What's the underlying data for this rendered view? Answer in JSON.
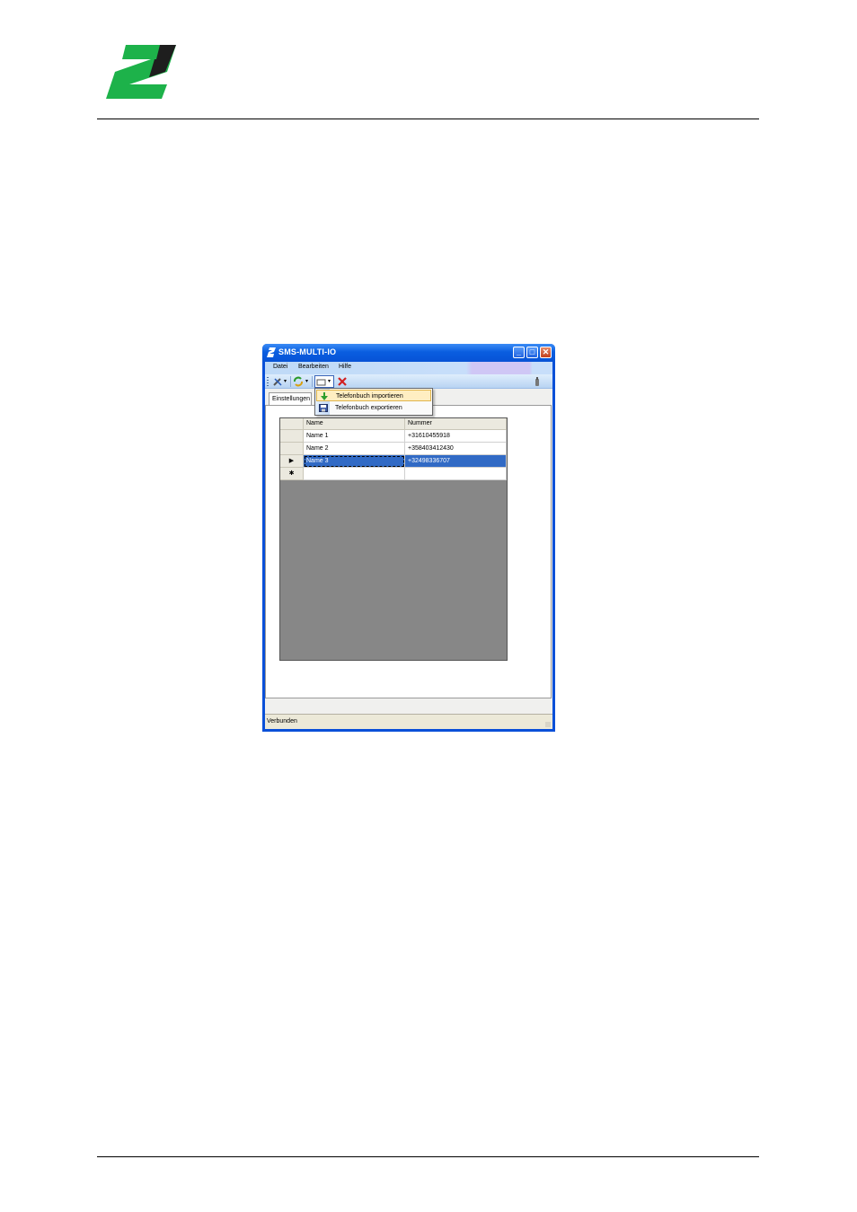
{
  "window": {
    "title": "SMS-MULTI-IO",
    "buttons": {
      "minimize": "_",
      "maximize": "□",
      "close": "✕"
    }
  },
  "menu": [
    "Datei",
    "Bearbeiten",
    "Hilfe"
  ],
  "toolbar": {
    "icons": [
      "tools-icon",
      "refresh-icon",
      "phonebook-icon",
      "delete-icon",
      "connection-icon"
    ],
    "dropdown_arrow": "▾"
  },
  "tabs": [
    "Einstellungen"
  ],
  "dropdown_menu": {
    "items": [
      {
        "label": "Telefonbuch importieren",
        "icon": "import-arrow-icon"
      },
      {
        "label": "Telefonbuch exportieren",
        "icon": "save-disk-icon"
      }
    ]
  },
  "grid": {
    "columns": [
      "Name",
      "Nummer"
    ],
    "rows": [
      {
        "marker": "",
        "name": "Name 1",
        "number": "+31610455918"
      },
      {
        "marker": "",
        "name": "Name 2",
        "number": "+358403412430"
      },
      {
        "marker": "▶",
        "name": "Name 3",
        "number": "+32498336707"
      },
      {
        "marker": "✱",
        "name": "",
        "number": ""
      }
    ]
  },
  "status": {
    "text": "Verbunden"
  },
  "colors": {
    "logo_green": "#1db24a",
    "logo_dark": "#1e1e1e",
    "selection": "#316ac5",
    "title_blue": "#0a5ee0"
  }
}
